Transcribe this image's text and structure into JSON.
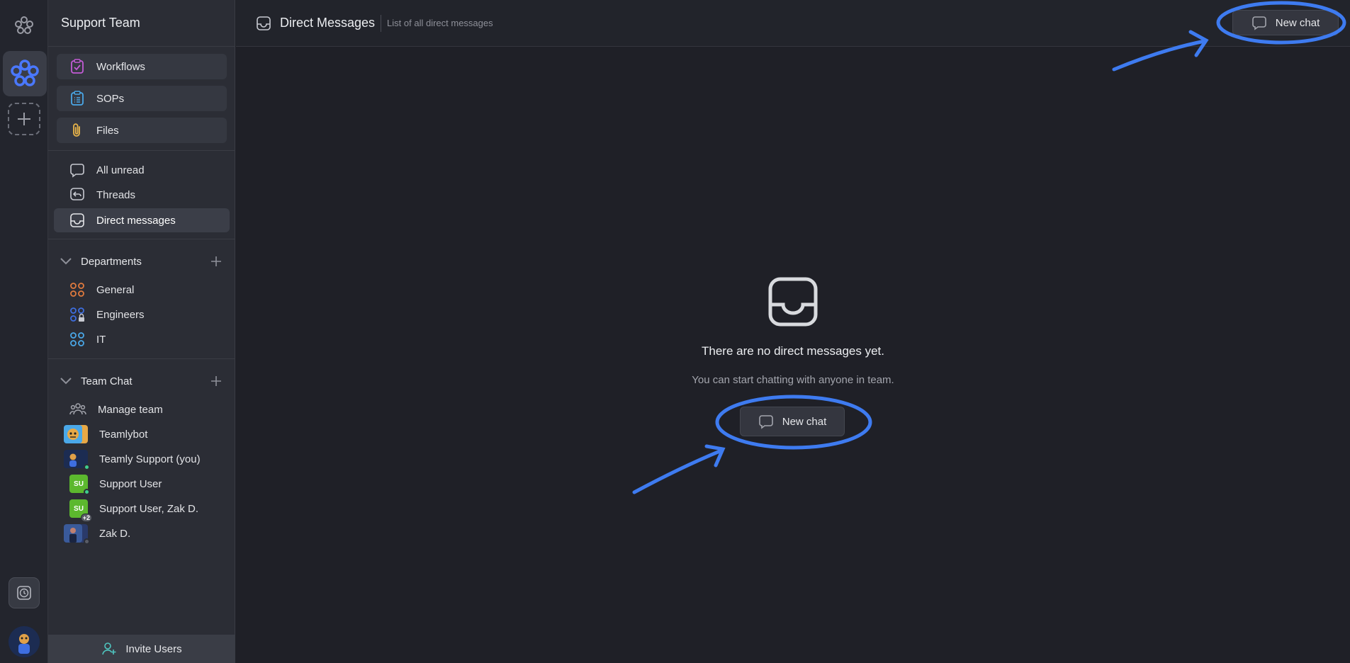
{
  "team": {
    "name": "Support Team"
  },
  "tools": [
    {
      "label": "Workflows",
      "icon": "clipboard-check-icon",
      "color": "#c35bd6"
    },
    {
      "label": "SOPs",
      "icon": "clipboard-list-icon",
      "color": "#4aa8e8"
    },
    {
      "label": "Files",
      "icon": "paperclip-icon",
      "color": "#e8b44a"
    }
  ],
  "nav": [
    {
      "label": "All unread",
      "icon": "chat-bubble-icon"
    },
    {
      "label": "Threads",
      "icon": "reply-icon"
    },
    {
      "label": "Direct messages",
      "icon": "inbox-icon",
      "active": true
    }
  ],
  "departments": {
    "title": "Departments",
    "items": [
      {
        "label": "General",
        "color": "#e07a3e"
      },
      {
        "label": "Engineers",
        "color": "#3e6ee0"
      },
      {
        "label": "IT",
        "color": "#4aa8e8"
      }
    ]
  },
  "team_chat": {
    "title": "Team Chat",
    "items": [
      {
        "label": "Manage team"
      },
      {
        "label": "Teamlybot"
      },
      {
        "label": "Teamly Support (you)"
      },
      {
        "label": "Support User",
        "initials": "SU"
      },
      {
        "label": "Support User, Zak D.",
        "initials": "SU",
        "count": "+2"
      },
      {
        "label": "Zak D."
      }
    ]
  },
  "invite_label": "Invite Users",
  "header": {
    "title": "Direct Messages",
    "subtitle": "List of all direct messages",
    "new_chat_label": "New chat"
  },
  "empty_state": {
    "title": "There are no direct messages yet.",
    "subtitle": "You can start chatting with anyone in team.",
    "button_label": "New chat"
  },
  "colors": {
    "accent_annotation": "#3e7bf0",
    "online": "#3ecf8e",
    "avatar_green": "#5cb82e"
  }
}
